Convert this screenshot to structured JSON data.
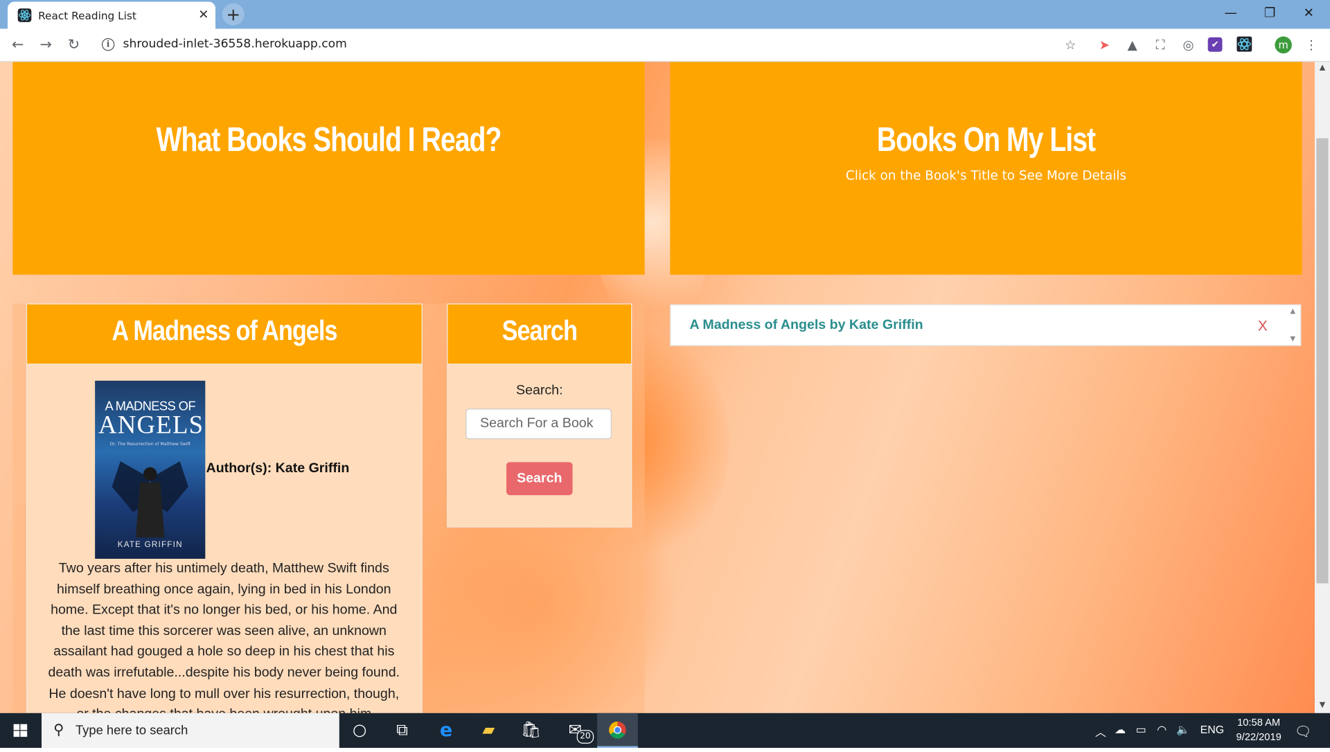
{
  "browser": {
    "tab_title": "React Reading List",
    "tab_close": "✕",
    "new_tab": "+",
    "url": "shrouded-inlet-36558.herokuapp.com",
    "window_controls": {
      "minimize": "—",
      "restore": "❐",
      "close": "✕"
    },
    "nav": {
      "back": "←",
      "forward": "→",
      "reload": "↻"
    },
    "profile_initial": "m",
    "extensions": [
      "star-icon",
      "cast-icon",
      "drive-icon",
      "screenshot-icon",
      "devtools-icon",
      "pocket-icon",
      "react-devtools-icon"
    ]
  },
  "header_left": {
    "title": "What Books Should I Read?"
  },
  "header_right": {
    "title": "Books On My List",
    "subtitle": "Click on the Book's Title to See More Details"
  },
  "book_card": {
    "title": "A Madness of Angels",
    "cover": {
      "series_line": "A MADNESS OF",
      "title_line": "ANGELS",
      "tagline": "Or, The Resurrection of Matthew Swift",
      "author_line": "KATE GRIFFIN"
    },
    "author_text": "Author(s): Kate Griffin",
    "description": "Two years after his untimely death, Matthew Swift finds himself breathing once again, lying in bed in his London home. Except that it's no longer his bed, or his home. And the last time this sorcerer was seen alive, an unknown assailant had gouged a hole so deep in his chest that his death was irrefutable...despite his body never being found. He doesn't have long to mull over his resurrection, though, or the changes that have been wrought upon him"
  },
  "search": {
    "heading": "Search",
    "label": "Search:",
    "placeholder": "Search For a Book",
    "button": "Search"
  },
  "my_list": {
    "items": [
      {
        "label": "A Madness of Angels by Kate Griffin",
        "remove": "X"
      }
    ]
  },
  "taskbar": {
    "search_placeholder": "Type here to search",
    "mail_badge": "20",
    "language": "ENG",
    "time": "10:58 AM",
    "date": "9/22/2019"
  },
  "colors": {
    "header_orange": "#ffa500",
    "search_button": "#e9686b",
    "list_link": "#2a8d8e",
    "remove_x": "#d9534f"
  }
}
